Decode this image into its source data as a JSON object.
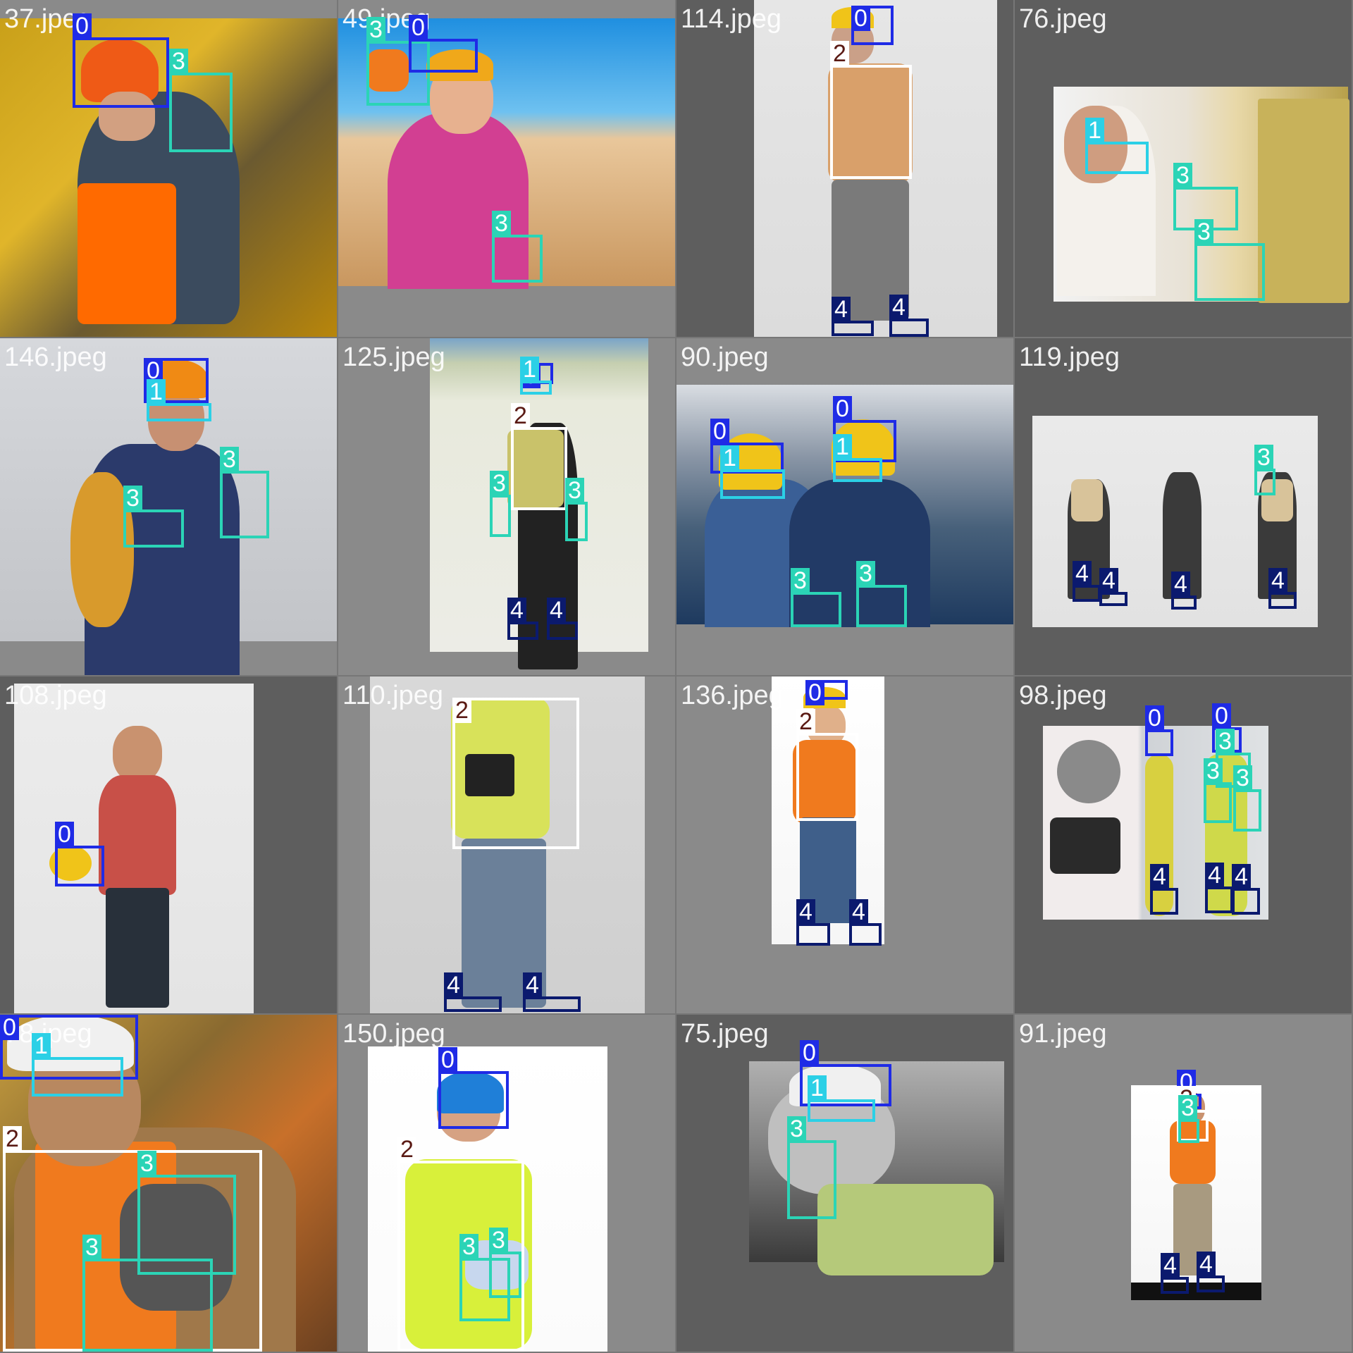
{
  "class_colors": {
    "0": "#1f2be6",
    "1": "#2bd0e6",
    "2": "#ffffff",
    "3": "#2bd4b6",
    "4": "#0b1a6e"
  },
  "class_label_text_colors": {
    "0": "#ffffff",
    "1": "#ffffff",
    "2": "#5a1a14",
    "3": "#ffffff",
    "4": "#ffffff"
  },
  "tiles": [
    {
      "file": "37.jpeg",
      "scene": "construction-worker-orange-helmet",
      "boxes": [
        {
          "cls": "0",
          "label": "0"
        },
        {
          "cls": "3",
          "label": "3"
        }
      ]
    },
    {
      "file": "49.jpeg",
      "scene": "woman-yellow-helmet-pink-shirt",
      "boxes": [
        {
          "cls": "3",
          "label": "3"
        },
        {
          "cls": "0",
          "label": "0"
        },
        {
          "cls": "3",
          "label": "3"
        }
      ]
    },
    {
      "file": "114.jpeg",
      "scene": "standing-worker-vest",
      "boxes": [
        {
          "cls": "0",
          "label": "0"
        },
        {
          "cls": "2",
          "label": "2"
        },
        {
          "cls": "4",
          "label": "4"
        },
        {
          "cls": "4",
          "label": "4"
        }
      ]
    },
    {
      "file": "76.jpeg",
      "scene": "worker-goggles-insulation",
      "boxes": [
        {
          "cls": "1",
          "label": "1"
        },
        {
          "cls": "3",
          "label": "3"
        },
        {
          "cls": "3",
          "label": "3"
        }
      ]
    },
    {
      "file": "146.jpeg",
      "scene": "worker-overalls-cable",
      "boxes": [
        {
          "cls": "0",
          "label": "0"
        },
        {
          "cls": "1",
          "label": "1"
        },
        {
          "cls": "3",
          "label": "3"
        },
        {
          "cls": "3",
          "label": "3"
        }
      ]
    },
    {
      "file": "125.jpeg",
      "scene": "ppe-poster",
      "boxes": [
        {
          "cls": "0",
          "label": "0"
        },
        {
          "cls": "1",
          "label": "1"
        },
        {
          "cls": "2",
          "label": "2"
        },
        {
          "cls": "3",
          "label": "3"
        },
        {
          "cls": "3",
          "label": "3"
        },
        {
          "cls": "4",
          "label": "4"
        },
        {
          "cls": "4",
          "label": "4"
        }
      ]
    },
    {
      "file": "90.jpeg",
      "scene": "two-workers-factory",
      "boxes": [
        {
          "cls": "0",
          "label": "0"
        },
        {
          "cls": "1",
          "label": "1"
        },
        {
          "cls": "0",
          "label": "0"
        },
        {
          "cls": "1",
          "label": "1"
        },
        {
          "cls": "3",
          "label": "3"
        },
        {
          "cls": "3",
          "label": "3"
        }
      ]
    },
    {
      "file": "119.jpeg",
      "scene": "three-workers-drilling",
      "boxes": [
        {
          "cls": "3",
          "label": "3"
        },
        {
          "cls": "4",
          "label": "4"
        },
        {
          "cls": "4",
          "label": "4"
        },
        {
          "cls": "4",
          "label": "4"
        },
        {
          "cls": "4",
          "label": "4"
        }
      ]
    },
    {
      "file": "108.jpeg",
      "scene": "worker-plaid-shirt-holding-helmet",
      "boxes": [
        {
          "cls": "0",
          "label": "0"
        }
      ]
    },
    {
      "file": "110.jpeg",
      "scene": "man-vest-clipboard",
      "boxes": [
        {
          "cls": "2",
          "label": "2"
        },
        {
          "cls": "4",
          "label": "4"
        },
        {
          "cls": "4",
          "label": "4"
        }
      ]
    },
    {
      "file": "136.jpeg",
      "scene": "child-construction-costume",
      "boxes": [
        {
          "cls": "0",
          "label": "0"
        },
        {
          "cls": "2",
          "label": "2"
        },
        {
          "cls": "4",
          "label": "4"
        },
        {
          "cls": "4",
          "label": "4"
        }
      ]
    },
    {
      "file": "98.jpeg",
      "scene": "product-listing-two-workers",
      "boxes": [
        {
          "cls": "0",
          "label": "0"
        },
        {
          "cls": "0",
          "label": "0"
        },
        {
          "cls": "3",
          "label": "3"
        },
        {
          "cls": "3",
          "label": "3"
        },
        {
          "cls": "3",
          "label": "3"
        },
        {
          "cls": "4",
          "label": "4"
        },
        {
          "cls": "4",
          "label": "4"
        },
        {
          "cls": "4",
          "label": "4"
        }
      ]
    },
    {
      "file": "78.jpeg",
      "scene": "bearded-worker-chains",
      "boxes": [
        {
          "cls": "0",
          "label": "0"
        },
        {
          "cls": "1",
          "label": "1"
        },
        {
          "cls": "2",
          "label": "2"
        },
        {
          "cls": "3",
          "label": "3"
        },
        {
          "cls": "3",
          "label": "3"
        }
      ]
    },
    {
      "file": "150.jpeg",
      "scene": "worker-blue-helmet-gloves",
      "boxes": [
        {
          "cls": "0",
          "label": "0"
        },
        {
          "cls": "2",
          "label": "2"
        },
        {
          "cls": "3",
          "label": "3"
        },
        {
          "cls": "3",
          "label": "3"
        }
      ]
    },
    {
      "file": "75.jpeg",
      "scene": "worker-radio-sunglasses",
      "boxes": [
        {
          "cls": "0",
          "label": "0"
        },
        {
          "cls": "1",
          "label": "1"
        },
        {
          "cls": "3",
          "label": "3"
        }
      ]
    },
    {
      "file": "91.jpeg",
      "scene": "small-worker-orange-vest",
      "boxes": [
        {
          "cls": "0",
          "label": "0"
        },
        {
          "cls": "2",
          "label": "2"
        },
        {
          "cls": "3",
          "label": "3"
        },
        {
          "cls": "4",
          "label": "4"
        },
        {
          "cls": "4",
          "label": "4"
        }
      ]
    }
  ]
}
